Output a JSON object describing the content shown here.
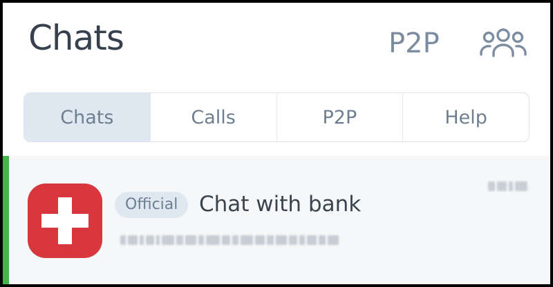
{
  "header": {
    "title": "Chats",
    "p2p_link": "P2P",
    "contacts_icon": "people-group-icon"
  },
  "tabs": [
    {
      "label": "Chats",
      "active": true
    },
    {
      "label": "Calls",
      "active": false
    },
    {
      "label": "P2P",
      "active": false
    },
    {
      "label": "Help",
      "active": false
    }
  ],
  "chat": {
    "badge": "Official",
    "name": "Chat with bank",
    "avatar_icon": "swiss-cross-icon",
    "preview": "",
    "time": "",
    "preview_obscured": true
  },
  "colors": {
    "accent": "#43b54b",
    "avatar": "#d7373d",
    "title": "#37414d",
    "muted": "#7c8ca0"
  }
}
